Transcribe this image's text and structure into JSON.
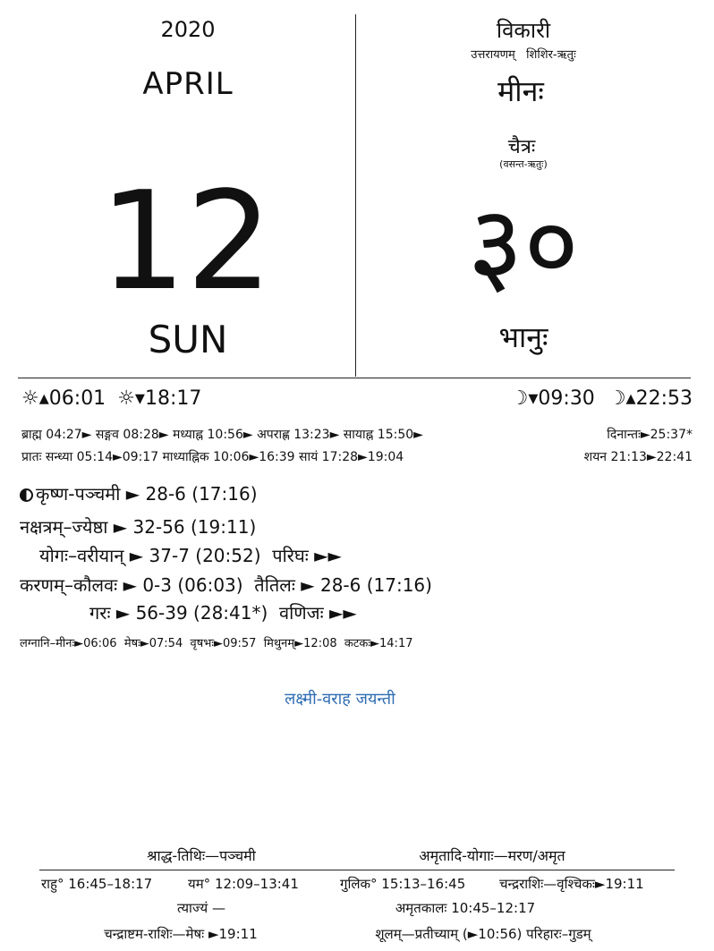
{
  "header": {
    "year": "2020",
    "month": "APRIL",
    "day": "12",
    "weekday": "SUN",
    "samvatsara": "विकारी",
    "ayana_ritu": "उत्तरायणम्   शिशिर-ऋतुः",
    "solar_month": "मीनः",
    "lunar_month": "चैत्रः",
    "lunar_ritu": "(वसन्त-ऋतुः)",
    "solar_day": "३०",
    "vasara": "भानुः"
  },
  "sun_moon": {
    "sunrise": "06:01",
    "sunset": "18:17",
    "moonset": "09:30",
    "moonrise": "22:53"
  },
  "periods": {
    "line1": "ब्राह्म 04:27► सङ्गव 08:28► मध्याह्न 10:56► अपराह्ण 13:23► सायाह्न 15:50►",
    "line1_right": "दिनान्तः►25:37*",
    "line2": "प्रातः सन्ध्या 05:14►09:17 माध्याह्निक 10:06►16:39 सायं 17:28►19:04",
    "line2_right": "शयन 21:13►22:41"
  },
  "panchanga": {
    "tithi": "कृष्ण-पञ्चमी ► 28-6 (17:16)",
    "nakshatra": "नक्षत्रम्–ज्येष्ठा ► 32-56 (19:11)",
    "yoga": "योगः–वरीयान् ► 37-7 (20:52)  परिघः ►►",
    "karana1": "करणम्–कौलवः ► 0-3 (06:03)  तैतिलः ► 28-6 (17:16)",
    "karana2": "गरः ► 56-39 (28:41*)  वणिजः ►►",
    "lagna": "लग्नानि–मीनः►06:06  मेषः►07:54  वृषभः►09:57  मिथुनम्►12:08  कटकः►14:17"
  },
  "festival": "लक्ष्मी-वराह जयन्ती",
  "footer": {
    "shraddha": "श्राद्ध-तिथिः—पञ्चमी",
    "amritadi": "अमृतादि-योगाः—मरण/अमृत",
    "rahu": "राहु° 16:45–18:17",
    "yama": "यम° 12:09–13:41",
    "gulika": "गुलिक° 15:13–16:45",
    "chandra_rashi": "चन्द्रराशिः—वृश्चिकः►19:11",
    "tyajya": "त्याज्यं —",
    "amritakala": "अमृतकालः 10:45–12:17",
    "chandrashtama": "चन्द्राष्टम-राशिः—मेषः ►19:11",
    "shula": "शूलम्—प्रतीच्याम् (►10:56) परिहारः–गुडम्"
  },
  "colors": {
    "text": "#111111",
    "festival": "#2f6db3"
  },
  "icons": [
    "sun-icon",
    "moon-icon",
    "moon-phase-icon"
  ]
}
